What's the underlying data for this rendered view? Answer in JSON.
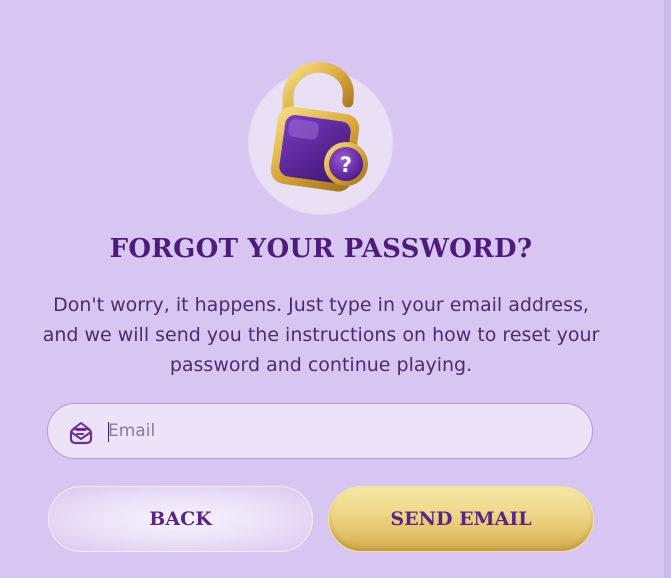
{
  "dialog": {
    "title": "FORGOT YOUR PASSWORD?",
    "description": "Don't worry, it happens. Just type in your email address, and we will send you the instructions on how to reset your password and continue playing.",
    "icon": "padlock-question-icon"
  },
  "email_field": {
    "placeholder": "Email",
    "value": "",
    "icon": "mail-icon"
  },
  "buttons": {
    "back_label": "BACK",
    "send_label": "SEND EMAIL"
  },
  "colors": {
    "background": "#d7c5f2",
    "title": "#4e1b7a",
    "body_text": "#4b2c6e",
    "button_gold": "#e6c86f",
    "button_light": "#ece3f8"
  }
}
